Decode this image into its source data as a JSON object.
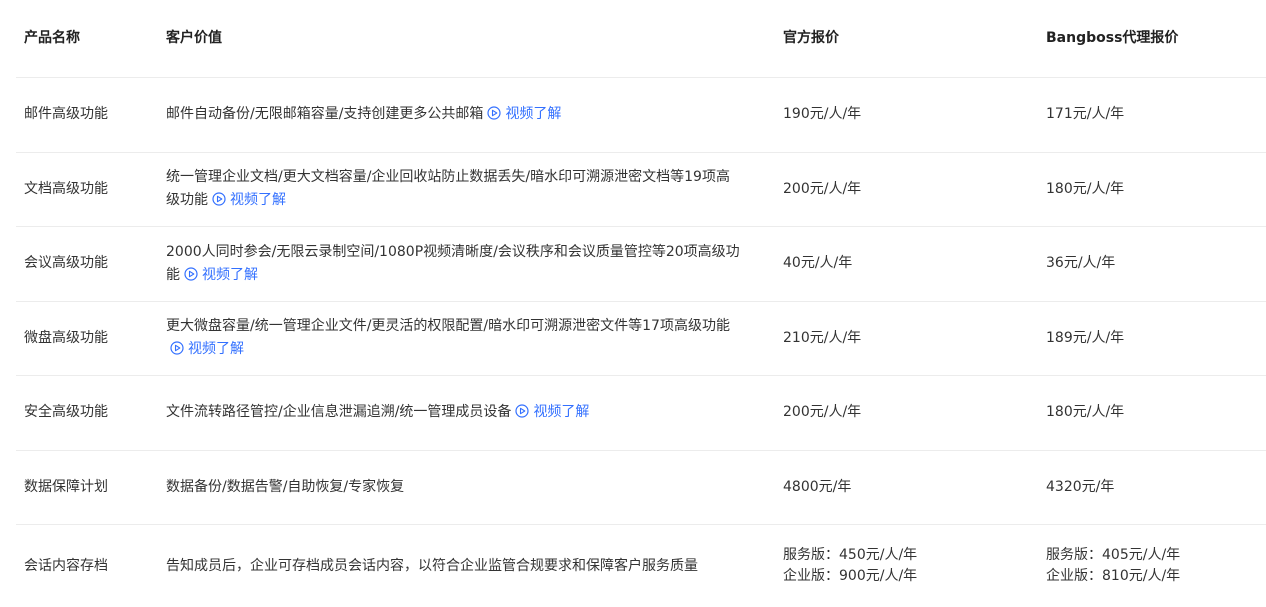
{
  "colors": {
    "link": "#3370ff",
    "text": "#333333",
    "divider": "#ececec"
  },
  "header": {
    "product": "产品名称",
    "value": "客户价值",
    "official_price": "官方报价",
    "agent_price": "Bangboss代理报价"
  },
  "video_label": "视频了解",
  "rows": [
    {
      "product": "邮件高级功能",
      "value": "邮件自动备份/无限邮箱容量/支持创建更多公共邮箱",
      "official": "190元/人/年",
      "agent": "171元/人/年"
    },
    {
      "product": "文档高级功能",
      "value": "统一管理企业文档/更大文档容量/企业回收站防止数据丢失/暗水印可溯源泄密文档等19项高级功能",
      "official": "200元/人/年",
      "agent": "180元/人/年"
    },
    {
      "product": "会议高级功能",
      "value": "2000人同时参会/无限云录制空间/1080P视频清晰度/会议秩序和会议质量管控等20项高级功能",
      "official": "40元/人/年",
      "agent": "36元/人/年"
    },
    {
      "product": "微盘高级功能",
      "value": "更大微盘容量/统一管理企业文件/更灵活的权限配置/暗水印可溯源泄密文件等17项高级功能",
      "official": "210元/人/年",
      "agent": "189元/人/年"
    },
    {
      "product": "安全高级功能",
      "value": "文件流转路径管控/企业信息泄漏追溯/统一管理成员设备",
      "official": "200元/人/年",
      "agent": "180元/人/年"
    },
    {
      "product": "数据保障计划",
      "value": "数据备份/数据告警/自助恢复/专家恢复",
      "official": "4800元/年",
      "agent": "4320元/年"
    },
    {
      "product": "会话内容存档",
      "value": "告知成员后，企业可存档成员会话内容，以符合企业监管合规要求和保障客户服务质量",
      "official_1": "服务版：450元/人/年",
      "official_2": "企业版：900元/人/年",
      "agent_1": "服务版：405元/人/年",
      "agent_2": "企业版：810元/人/年"
    }
  ]
}
